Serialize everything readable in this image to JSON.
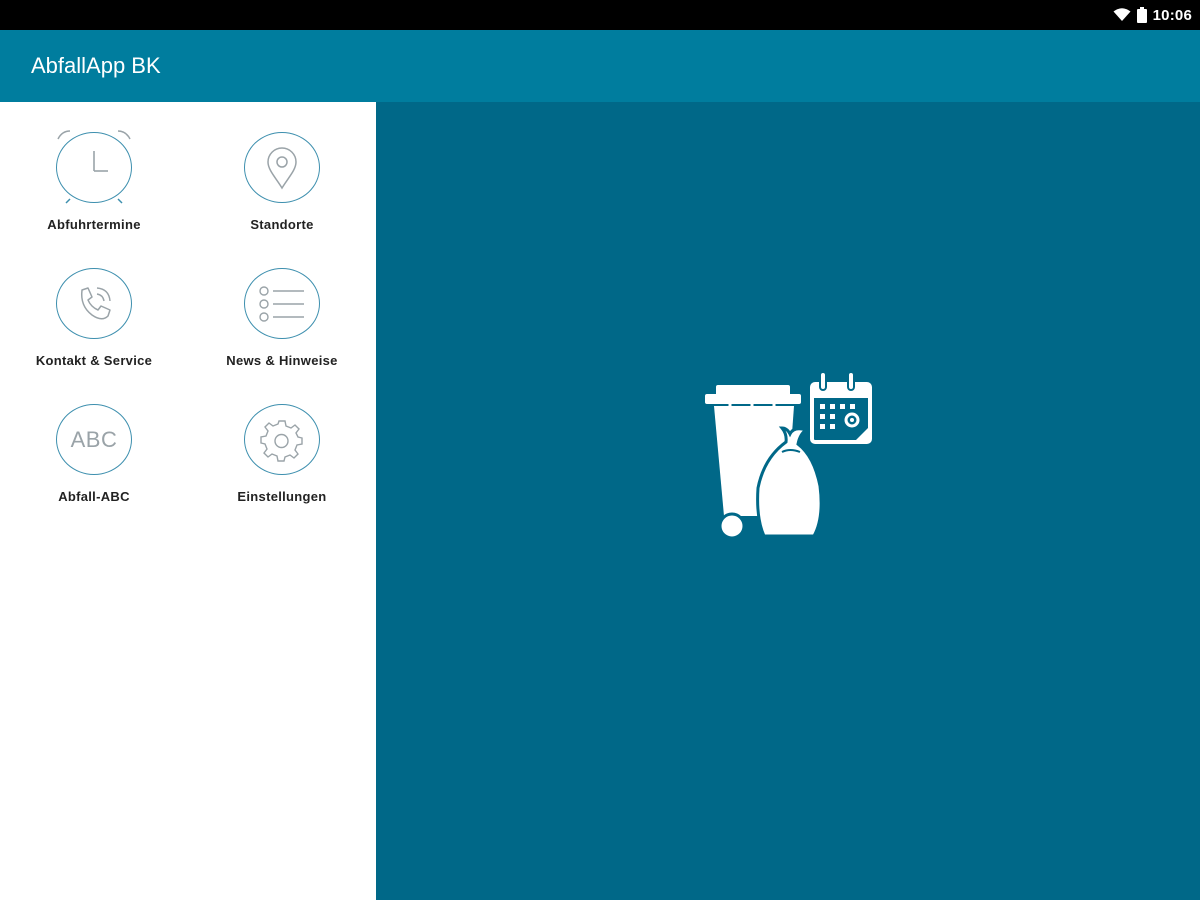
{
  "status_bar": {
    "time": "10:06",
    "icons": [
      "wifi-icon",
      "battery-icon"
    ]
  },
  "app_bar": {
    "title": "AbfallApp BK",
    "color": "#007d9e"
  },
  "menu": {
    "items": [
      {
        "label": "Abfuhrtermine",
        "icon": "alarm-clock-icon"
      },
      {
        "label": "Standorte",
        "icon": "location-pin-icon"
      },
      {
        "label": "Kontakt & Service",
        "icon": "phone-icon"
      },
      {
        "label": "News & Hinweise",
        "icon": "list-icon"
      },
      {
        "label": "Abfall-ABC",
        "icon": "abc-icon",
        "icon_text": "ABC"
      },
      {
        "label": "Einstellungen",
        "icon": "gear-icon"
      }
    ],
    "icon_ring_color": "#3d8fae"
  },
  "main": {
    "background": "#006888",
    "illustration": "waste-bin-calendar-icon"
  }
}
